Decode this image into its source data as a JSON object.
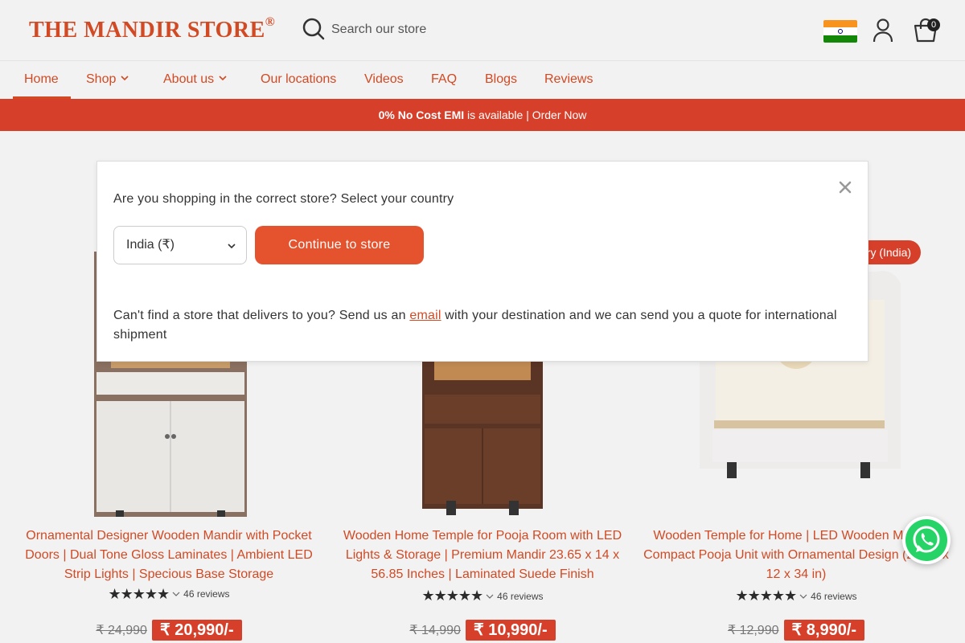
{
  "header": {
    "logo_text": "THE MANDIR STORE",
    "logo_mark": "®",
    "search_placeholder": "Search our store",
    "cart_count": "0",
    "brand_color": "#d14a24"
  },
  "nav": {
    "items": [
      {
        "label": "Home",
        "has_dropdown": false,
        "active": true
      },
      {
        "label": "Shop",
        "has_dropdown": true
      },
      {
        "label": "About us",
        "has_dropdown": true
      },
      {
        "label": "Our locations",
        "has_dropdown": false
      },
      {
        "label": "Videos",
        "has_dropdown": false
      },
      {
        "label": "FAQ",
        "has_dropdown": false
      },
      {
        "label": "Blogs",
        "has_dropdown": false
      },
      {
        "label": "Reviews",
        "has_dropdown": false
      }
    ]
  },
  "announcement": {
    "bold": "0% No Cost EMI",
    "rest": " is available | Order Now",
    "color": "#d6402a"
  },
  "badge_text": "ery (India)",
  "products": [
    {
      "title": "Ornamental Designer Wooden Mandir with Pocket Doors | Dual Tone Gloss Laminates | Ambient LED Strip Lights | Specious Base Storage",
      "reviews": "46 reviews",
      "rating": 4.5,
      "old_price": "₹ 24,990",
      "new_price": "₹ 20,990/-"
    },
    {
      "title": "Wooden Home Temple for Pooja Room with LED Lights & Storage | Premium Mandir 23.65 x 14 x 56.85 Inches | Laminated Suede Finish",
      "reviews": "46 reviews",
      "rating": 4.5,
      "old_price": "₹ 14,990",
      "new_price": "₹ 10,990/-"
    },
    {
      "title": "Wooden Temple for Home | LED Wooden Mandir | Compact Pooja Unit with Ornamental Design (23.65 x 12 x 34 in)",
      "reviews": "46 reviews",
      "rating": 4.5,
      "old_price": "₹ 12,990",
      "new_price": "₹ 8,990/-"
    }
  ],
  "modal": {
    "heading": "Are you shopping in the correct store? Select your country",
    "selected_country": "India (₹)",
    "continue_label": "Continue to store",
    "footer_before": "Can't find a store that delivers to you? Send us an ",
    "footer_link": "email",
    "footer_after": " with your destination and we can send you a quote for international shipment"
  }
}
